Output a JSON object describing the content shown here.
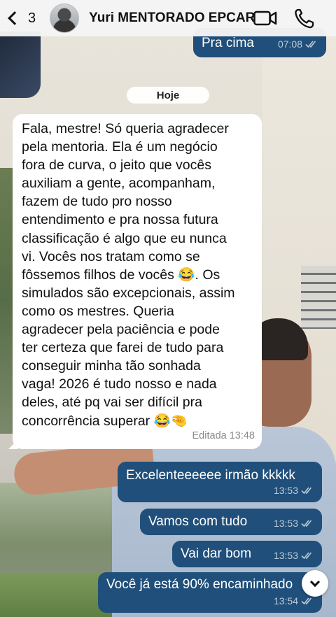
{
  "header": {
    "back_count": "3",
    "contact_name": "Yuri MENTORADO EPCAR"
  },
  "date_separator": "Hoje",
  "messages": [
    {
      "direction": "outgoing",
      "text": "Pra cima",
      "time": "07:08",
      "edited": "",
      "status": "read"
    },
    {
      "direction": "incoming",
      "text": "Fala, mestre! Só queria agradecer\npela mentoria. Ela é um negócio\nfora de curva, o jeito que vocês\nauxiliam a gente, acompanham,\nfazem de tudo pro nosso\nentendimento e pra nossa futura\nclassificação é algo que eu nunca\nvi. Vocês nos tratam como se\nfôssemos filhos de vocês 😂. Os\nsimulados são excepcionais, assim\ncomo os mestres. Queria\nagradecer pela paciência e pode\nter certeza que farei de tudo para\nconseguir minha tão sonhada\nvaga! 2026 é tudo nosso e nada\ndeles, até pq vai ser difícil pra\nconcorrência superar 😂🤏",
      "time": "13:48",
      "edited": "Editada"
    },
    {
      "direction": "outgoing",
      "text": "Excelenteeeeee irmão kkkkk",
      "time": "13:53",
      "status": "read"
    },
    {
      "direction": "outgoing",
      "text": "Vamos com tudo",
      "time": "13:53",
      "status": "read"
    },
    {
      "direction": "outgoing",
      "text": "Vai dar bom",
      "time": "13:53",
      "status": "read"
    },
    {
      "direction": "outgoing",
      "text": "Você já está 90% encaminhado",
      "time": "13:54",
      "status": "read"
    }
  ],
  "icons": {
    "back": "chevron-left-icon",
    "video": "video-camera-icon",
    "phone": "phone-icon",
    "read": "double-check-icon",
    "scroll": "chevron-down-icon"
  },
  "colors": {
    "outgoing_bubble": "#1f4f7a",
    "incoming_bubble": "#ffffff",
    "header_bg": "#f5f5f5"
  }
}
